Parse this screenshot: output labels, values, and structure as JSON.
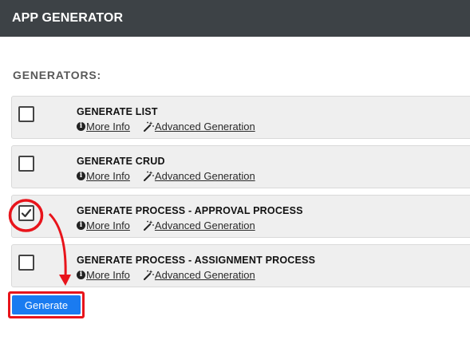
{
  "header": {
    "title": "APP GENERATOR"
  },
  "section": {
    "title": "GENERATORS:"
  },
  "generators": [
    {
      "title": "GENERATE LIST",
      "checked": false,
      "more_info": "More Info",
      "advanced": "Advanced Generation"
    },
    {
      "title": "GENERATE CRUD",
      "checked": false,
      "more_info": "More Info",
      "advanced": "Advanced Generation"
    },
    {
      "title": "GENERATE PROCESS - APPROVAL PROCESS",
      "checked": true,
      "more_info": "More Info",
      "advanced": "Advanced Generation"
    },
    {
      "title": "GENERATE PROCESS - ASSIGNMENT PROCESS",
      "checked": false,
      "more_info": "More Info",
      "advanced": "Advanced Generation"
    }
  ],
  "actions": {
    "generate_label": "Generate"
  },
  "icons": {
    "info": "info-icon",
    "advanced": "magic-wand-icon",
    "check": "check-icon"
  },
  "colors": {
    "header_bg": "#3d4246",
    "row_bg": "#efefef",
    "button_bg": "#1a7bf0",
    "annotation": "#e8141b"
  }
}
